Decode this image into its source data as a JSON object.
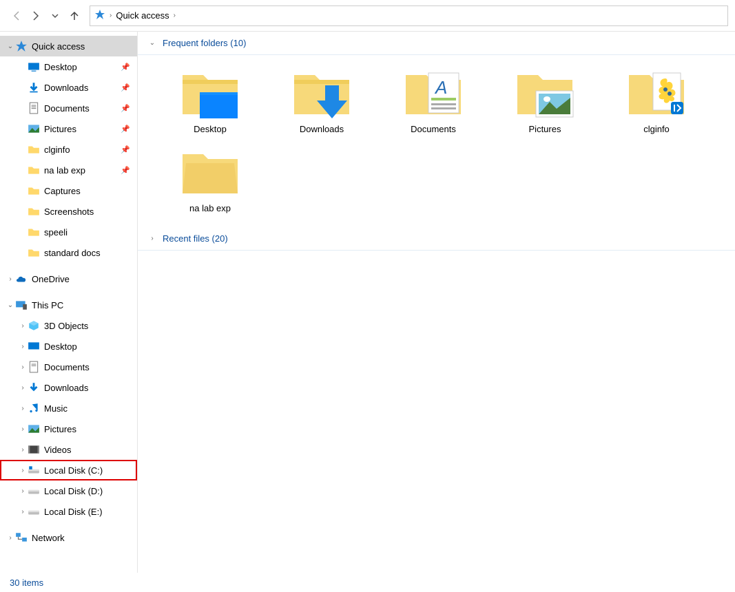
{
  "address": {
    "location": "Quick access"
  },
  "sidebar": {
    "quick_access": {
      "label": "Quick access",
      "items": [
        {
          "label": "Desktop",
          "pinned": true,
          "icon": "monitor"
        },
        {
          "label": "Downloads",
          "pinned": true,
          "icon": "download"
        },
        {
          "label": "Documents",
          "pinned": true,
          "icon": "document"
        },
        {
          "label": "Pictures",
          "pinned": true,
          "icon": "picture"
        },
        {
          "label": "clginfo",
          "pinned": true,
          "icon": "folder"
        },
        {
          "label": "na lab exp",
          "pinned": true,
          "icon": "folder"
        },
        {
          "label": "Captures",
          "pinned": false,
          "icon": "folder"
        },
        {
          "label": "Screenshots",
          "pinned": false,
          "icon": "folder"
        },
        {
          "label": "speeli",
          "pinned": false,
          "icon": "folder"
        },
        {
          "label": "standard docs",
          "pinned": false,
          "icon": "folder"
        }
      ]
    },
    "onedrive": {
      "label": "OneDrive"
    },
    "this_pc": {
      "label": "This PC",
      "items": [
        {
          "label": "3D Objects",
          "icon": "3d"
        },
        {
          "label": "Desktop",
          "icon": "monitor"
        },
        {
          "label": "Documents",
          "icon": "document"
        },
        {
          "label": "Downloads",
          "icon": "download"
        },
        {
          "label": "Music",
          "icon": "music"
        },
        {
          "label": "Pictures",
          "icon": "picture"
        },
        {
          "label": "Videos",
          "icon": "video"
        },
        {
          "label": "Local Disk (C:)",
          "icon": "disk",
          "highlighted": true
        },
        {
          "label": "Local Disk (D:)",
          "icon": "disk"
        },
        {
          "label": "Local Disk (E:)",
          "icon": "disk"
        }
      ]
    },
    "network": {
      "label": "Network"
    }
  },
  "content": {
    "group_frequent": {
      "label": "Frequent folders (10)"
    },
    "group_recent": {
      "label": "Recent files (20)"
    },
    "folders": [
      {
        "name": "Desktop",
        "type": "desktop"
      },
      {
        "name": "Downloads",
        "type": "download"
      },
      {
        "name": "Documents",
        "type": "document"
      },
      {
        "name": "Pictures",
        "type": "picture"
      },
      {
        "name": "clginfo",
        "type": "clginfo"
      },
      {
        "name": "na lab exp",
        "type": "folder"
      }
    ]
  },
  "status": {
    "text": "30 items"
  }
}
